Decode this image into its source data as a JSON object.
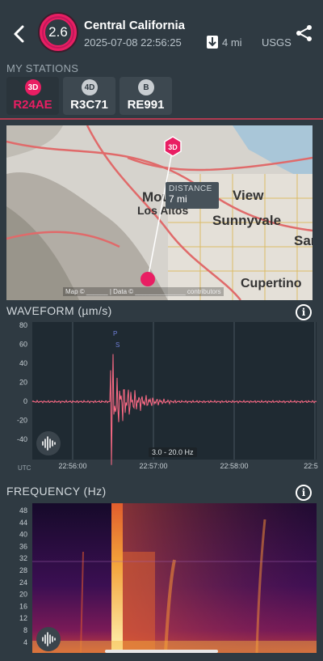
{
  "header": {
    "magnitude": "2.6",
    "region": "Central California",
    "datetime": "2025-07-08 22:56:25",
    "distance": "4 mi",
    "source": "USGS"
  },
  "stations": {
    "label": "MY STATIONS",
    "items": [
      {
        "type": "3D",
        "code": "R24AE",
        "active": true
      },
      {
        "type": "4D",
        "code": "R3C71",
        "active": false
      },
      {
        "type": "B",
        "code": "RE991",
        "active": false
      }
    ]
  },
  "map": {
    "places": [
      "Mountain View",
      "Los Altos",
      "Sunnyvale",
      "San",
      "Cupertino"
    ],
    "station_marker": "3D",
    "distance_label": "DISTANCE",
    "distance_value": "7 mi",
    "attribution": "Map © ______ | Data © ______________ contributors"
  },
  "waveform": {
    "title": "WAVEFORM (µm/s)",
    "info": "i",
    "y_ticks": [
      "80",
      "60",
      "40",
      "20",
      "0",
      "-20",
      "-40"
    ],
    "x_ticks": [
      "22:56:00",
      "22:57:00",
      "22:58:00",
      "22:5"
    ],
    "tz": "UTC",
    "filter": "3.0 - 20.0 Hz",
    "p_label": "P",
    "s_label": "S",
    "trace_color": "#ff6b86"
  },
  "frequency": {
    "title": "FREQUENCY (Hz)",
    "info": "i",
    "y_ticks": [
      "48",
      "44",
      "40",
      "36",
      "32",
      "28",
      "24",
      "20",
      "16",
      "12",
      "8",
      "4"
    ]
  },
  "colors": {
    "accent": "#e91e63",
    "bg": "#2f3a42",
    "plot_bg": "#1f2a32"
  },
  "icons": {
    "back": "back-chevron-icon",
    "share": "share-icon",
    "download": "download-arrow-icon",
    "waveform": "waveform-icon",
    "info": "info-icon"
  }
}
